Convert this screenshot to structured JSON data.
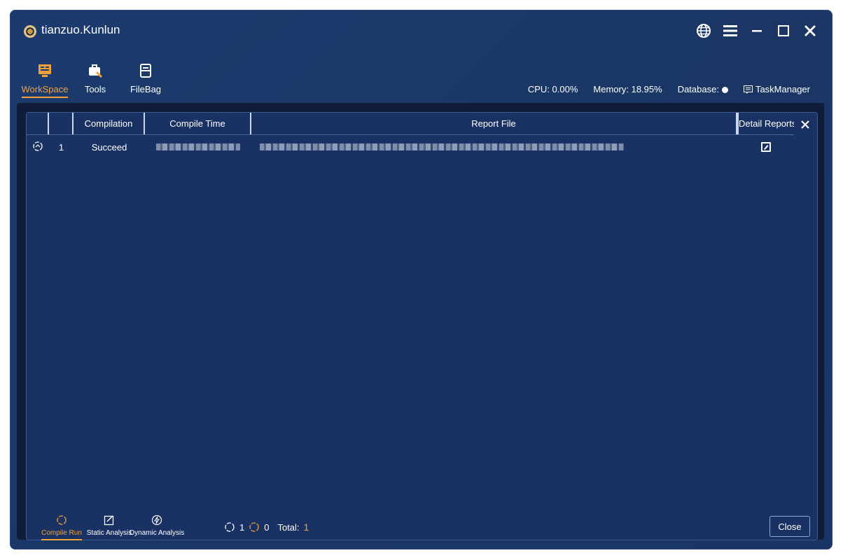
{
  "app": {
    "title": "tianzuo.Kunlun"
  },
  "nav": [
    {
      "label": "WorkSpace",
      "icon": "workspace-icon",
      "active": true
    },
    {
      "label": "Tools",
      "icon": "tools-icon",
      "active": false
    },
    {
      "label": "FileBag",
      "icon": "filebag-icon",
      "active": false
    }
  ],
  "status": {
    "cpu": "CPU: 0.00%",
    "memory": "Memory: 18.95%",
    "database": "Database:",
    "taskmanager": "TaskManager"
  },
  "table": {
    "headers": [
      "",
      "",
      "Compilation",
      "Compile Time",
      "Report File",
      "Detail Reports"
    ],
    "rows": [
      {
        "index": "1",
        "compilation": "Succeed",
        "compile_time": "",
        "report_file": ""
      }
    ]
  },
  "tabs": [
    {
      "label": "Compile Run",
      "icon": "compile-run-icon",
      "active": true
    },
    {
      "label": "Static Analysis",
      "icon": "static-analysis-icon",
      "active": false
    },
    {
      "label": "Dynamic Analysis",
      "icon": "dynamic-analysis-icon",
      "active": false
    }
  ],
  "summary": {
    "success_count": "1",
    "fail_count": "0",
    "total_label": "Total:",
    "total_value": "1"
  },
  "buttons": {
    "close": "Close"
  },
  "colors": {
    "accent": "#f0a33a",
    "background": "#1a3263",
    "window": "#1c3a6e"
  }
}
